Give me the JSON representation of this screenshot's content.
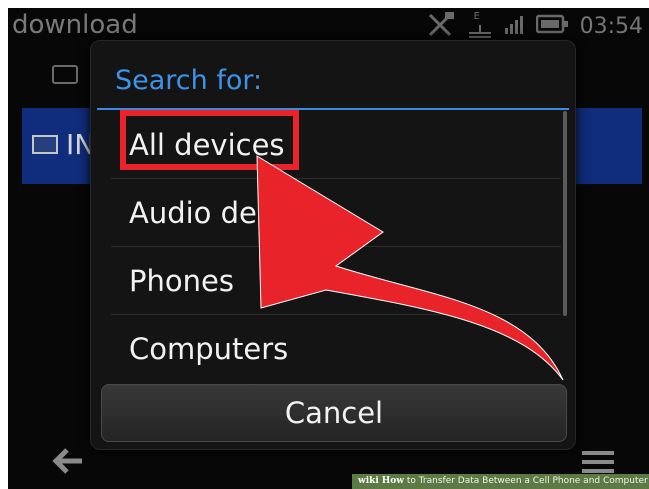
{
  "status_bar": {
    "app_title": "download",
    "time": "03:54",
    "icons": [
      "no-sim-icon",
      "usb-icon",
      "signal-icon",
      "battery-icon"
    ],
    "usb_letter": "E"
  },
  "background": {
    "row_label": "IN",
    "row_icon": "image-icon",
    "folder_icon": "folder-icon",
    "bottom_icons": [
      "back-arrow-icon",
      "menu-icon"
    ]
  },
  "dialog": {
    "title": "Search for:",
    "options": [
      {
        "label": "All devices",
        "highlighted": true
      },
      {
        "label": "Audio devices"
      },
      {
        "label": "Phones"
      },
      {
        "label": "Computers"
      }
    ],
    "cancel_label": "Cancel"
  },
  "annotation": {
    "highlight_color": "#e8242a",
    "arrow_color": "#e8242a"
  },
  "watermark": {
    "logo": "wiki",
    "how": "How",
    "text": "to Transfer Data Between a Cell Phone and Computer"
  },
  "colors": {
    "accent": "#3d93e8",
    "selection": "#0f2d7c"
  }
}
